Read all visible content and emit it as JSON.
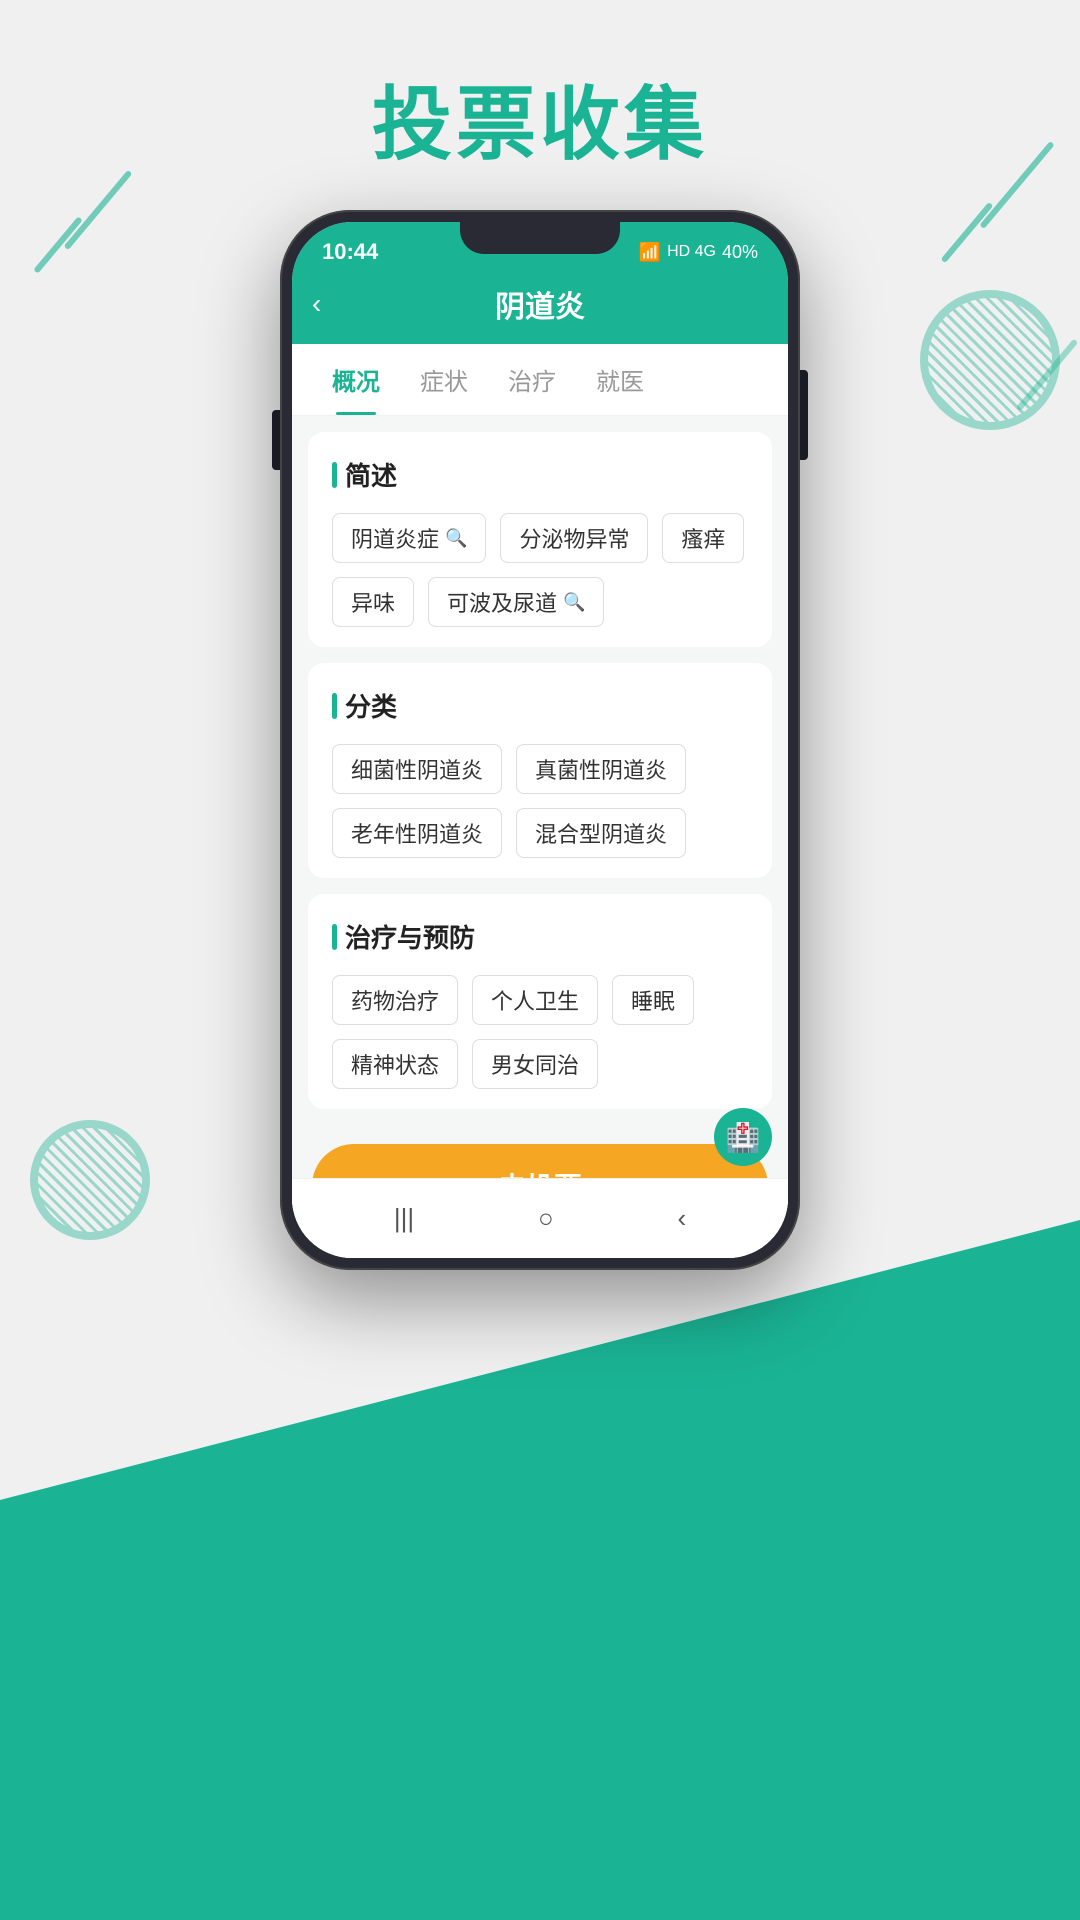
{
  "page": {
    "title": "投票收集"
  },
  "phone": {
    "status": {
      "time": "10:44",
      "battery": "40%"
    },
    "header": {
      "title": "阴道炎",
      "back_label": "‹"
    },
    "tabs": [
      {
        "label": "概况",
        "active": true
      },
      {
        "label": "症状",
        "active": false
      },
      {
        "label": "治疗",
        "active": false
      },
      {
        "label": "就医",
        "active": false
      }
    ],
    "sections": [
      {
        "title": "简述",
        "tags": [
          {
            "label": "阴道炎症",
            "has_search": true
          },
          {
            "label": "分泌物异常",
            "has_search": false
          },
          {
            "label": "瘙痒",
            "has_search": false
          },
          {
            "label": "异味",
            "has_search": false
          },
          {
            "label": "可波及尿道",
            "has_search": true
          }
        ]
      },
      {
        "title": "分类",
        "tags": [
          {
            "label": "细菌性阴道炎",
            "has_search": false
          },
          {
            "label": "真菌性阴道炎",
            "has_search": false
          },
          {
            "label": "老年性阴道炎",
            "has_search": false
          },
          {
            "label": "混合型阴道炎",
            "has_search": false
          }
        ]
      },
      {
        "title": "治疗与预防",
        "tags": [
          {
            "label": "药物治疗",
            "has_search": false
          },
          {
            "label": "个人卫生",
            "has_search": false
          },
          {
            "label": "睡眠",
            "has_search": false
          },
          {
            "label": "精神状态",
            "has_search": false
          },
          {
            "label": "男女同治",
            "has_search": false
          }
        ]
      }
    ],
    "vote_button": "去投票",
    "nav": {
      "back_icon": "|||",
      "home_icon": "○",
      "return_icon": "‹"
    }
  }
}
